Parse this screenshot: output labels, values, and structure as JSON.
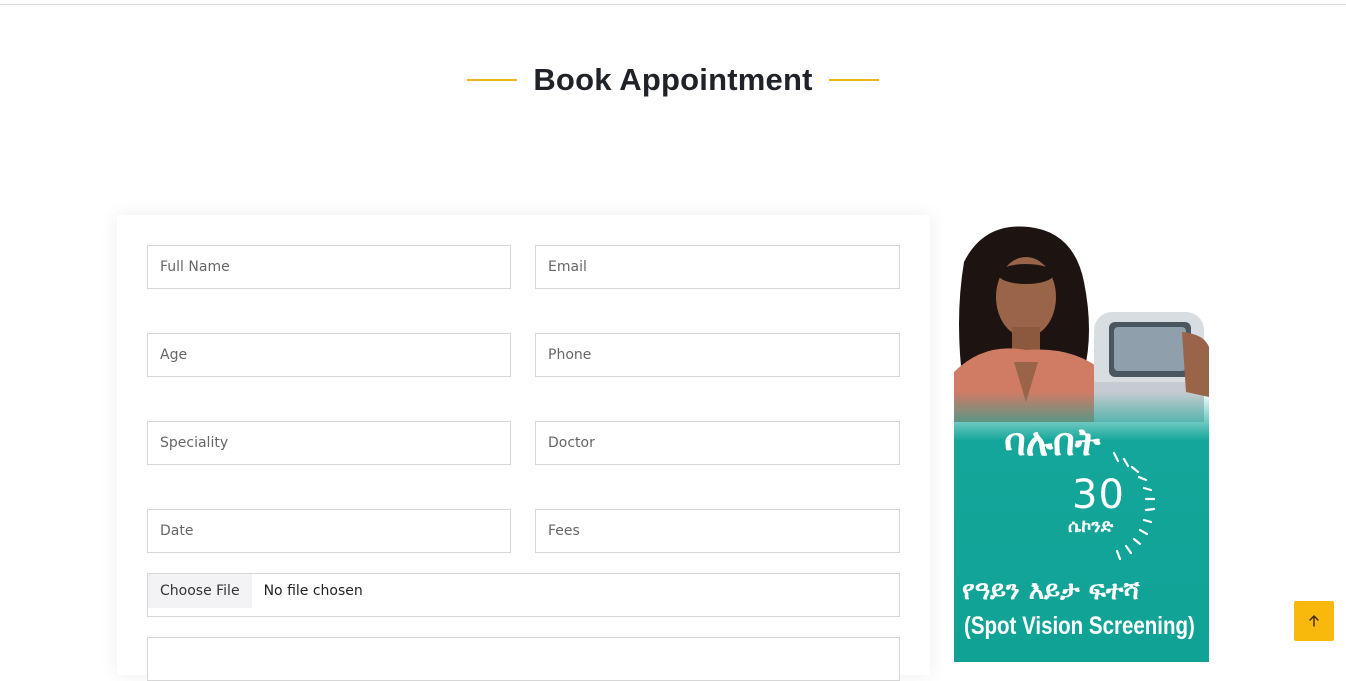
{
  "section": {
    "title": "Book Appointment"
  },
  "form": {
    "full_name_placeholder": "Full Name",
    "email_placeholder": "Email",
    "age_placeholder": "Age",
    "phone_placeholder": "Phone",
    "speciality_placeholder": "Speciality",
    "doctor_placeholder": "Doctor",
    "date_placeholder": "Date",
    "fees_placeholder": "Fees",
    "file_button_label": "Choose File",
    "file_status": "No file chosen"
  },
  "promo": {
    "headline": "ባሉበት",
    "number": "30",
    "unit": "ሴኮንድ",
    "subtitle": "የዓይን እይታ ፍተሻ",
    "english": "(Spot Vision Screening)",
    "accent_color": "#12a89b"
  },
  "colors": {
    "title_accent": "#f0b51b",
    "scroll_button": "#f8b80c"
  },
  "icons": {
    "scroll_top": "arrow-up-icon"
  }
}
